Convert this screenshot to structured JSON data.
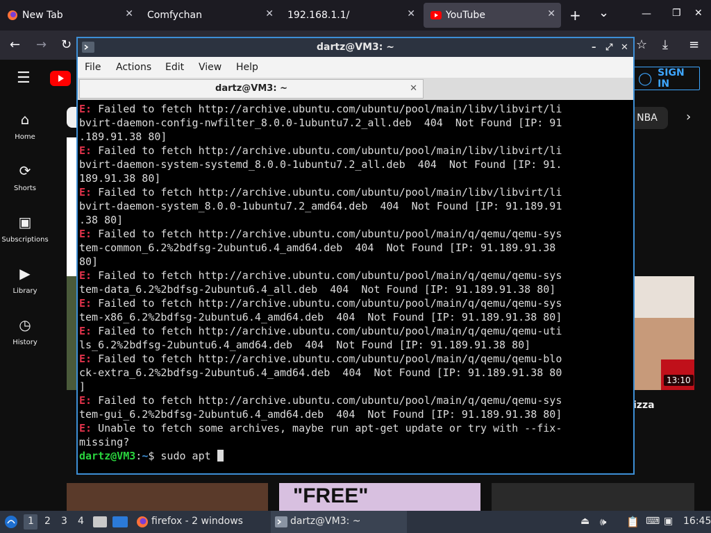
{
  "browser": {
    "tabs": [
      {
        "label": "New Tab"
      },
      {
        "label": "Comfychan"
      },
      {
        "label": "192.168.1.1/"
      },
      {
        "label": "YouTube"
      }
    ],
    "new_tab": "+",
    "tab_list": "⌄"
  },
  "youtube": {
    "sign_in": "SIGN IN",
    "chip_nba": "NBA",
    "sidebar": [
      {
        "label": "Home",
        "icon": "home-icon"
      },
      {
        "label": "Shorts",
        "icon": "shorts-icon"
      },
      {
        "label": "Subscriptions",
        "icon": "subscriptions-icon"
      },
      {
        "label": "Library",
        "icon": "library-icon"
      },
      {
        "label": "History",
        "icon": "history-icon"
      }
    ],
    "video_duration": "13:10",
    "video_title_fragment": "izza",
    "thumb_text": "\"FREE\""
  },
  "terminal": {
    "title": "dartz@VM3: ~",
    "tab_title": "dartz@VM3: ~",
    "menu": [
      "File",
      "Actions",
      "Edit",
      "View",
      "Help"
    ],
    "lines": [
      {
        "err": "E:",
        "text": " Failed to fetch http://archive.ubuntu.com/ubuntu/pool/main/libv/libvirt/li\nbvirt-daemon-config-nwfilter_8.0.0-1ubuntu7.2_all.deb  404  Not Found [IP: 91\n.189.91.38 80]"
      },
      {
        "err": "E:",
        "text": " Failed to fetch http://archive.ubuntu.com/ubuntu/pool/main/libv/libvirt/li\nbvirt-daemon-system-systemd_8.0.0-1ubuntu7.2_all.deb  404  Not Found [IP: 91.\n189.91.38 80]"
      },
      {
        "err": "E:",
        "text": " Failed to fetch http://archive.ubuntu.com/ubuntu/pool/main/libv/libvirt/li\nbvirt-daemon-system_8.0.0-1ubuntu7.2_amd64.deb  404  Not Found [IP: 91.189.91\n.38 80]"
      },
      {
        "err": "E:",
        "text": " Failed to fetch http://archive.ubuntu.com/ubuntu/pool/main/q/qemu/qemu-sys\ntem-common_6.2%2bdfsg-2ubuntu6.4_amd64.deb  404  Not Found [IP: 91.189.91.38\n80]"
      },
      {
        "err": "E:",
        "text": " Failed to fetch http://archive.ubuntu.com/ubuntu/pool/main/q/qemu/qemu-sys\ntem-data_6.2%2bdfsg-2ubuntu6.4_all.deb  404  Not Found [IP: 91.189.91.38 80]"
      },
      {
        "err": "E:",
        "text": " Failed to fetch http://archive.ubuntu.com/ubuntu/pool/main/q/qemu/qemu-sys\ntem-x86_6.2%2bdfsg-2ubuntu6.4_amd64.deb  404  Not Found [IP: 91.189.91.38 80]"
      },
      {
        "err": "E:",
        "text": " Failed to fetch http://archive.ubuntu.com/ubuntu/pool/main/q/qemu/qemu-uti\nls_6.2%2bdfsg-2ubuntu6.4_amd64.deb  404  Not Found [IP: 91.189.91.38 80]"
      },
      {
        "err": "E:",
        "text": " Failed to fetch http://archive.ubuntu.com/ubuntu/pool/main/q/qemu/qemu-blo\nck-extra_6.2%2bdfsg-2ubuntu6.4_amd64.deb  404  Not Found [IP: 91.189.91.38 80\n]"
      },
      {
        "err": "E:",
        "text": " Failed to fetch http://archive.ubuntu.com/ubuntu/pool/main/q/qemu/qemu-sys\ntem-gui_6.2%2bdfsg-2ubuntu6.4_amd64.deb  404  Not Found [IP: 91.189.91.38 80]"
      },
      {
        "err": "E:",
        "text": " Unable to fetch some archives, maybe run apt-get update or try with --fix-\nmissing?"
      }
    ],
    "prompt_user": "dartz@VM3",
    "prompt_sep": ":",
    "prompt_path": "~",
    "prompt_sym": "$ ",
    "command": "sudo apt "
  },
  "taskbar": {
    "workspaces": [
      "1",
      "2",
      "3",
      "4"
    ],
    "firefox_label": "firefox - 2 windows",
    "terminal_label": "dartz@VM3: ~",
    "clock": "16:45"
  },
  "colors": {
    "error": "#e2334b",
    "prompt": "#2ad43e",
    "accent": "#3d8fd6"
  }
}
